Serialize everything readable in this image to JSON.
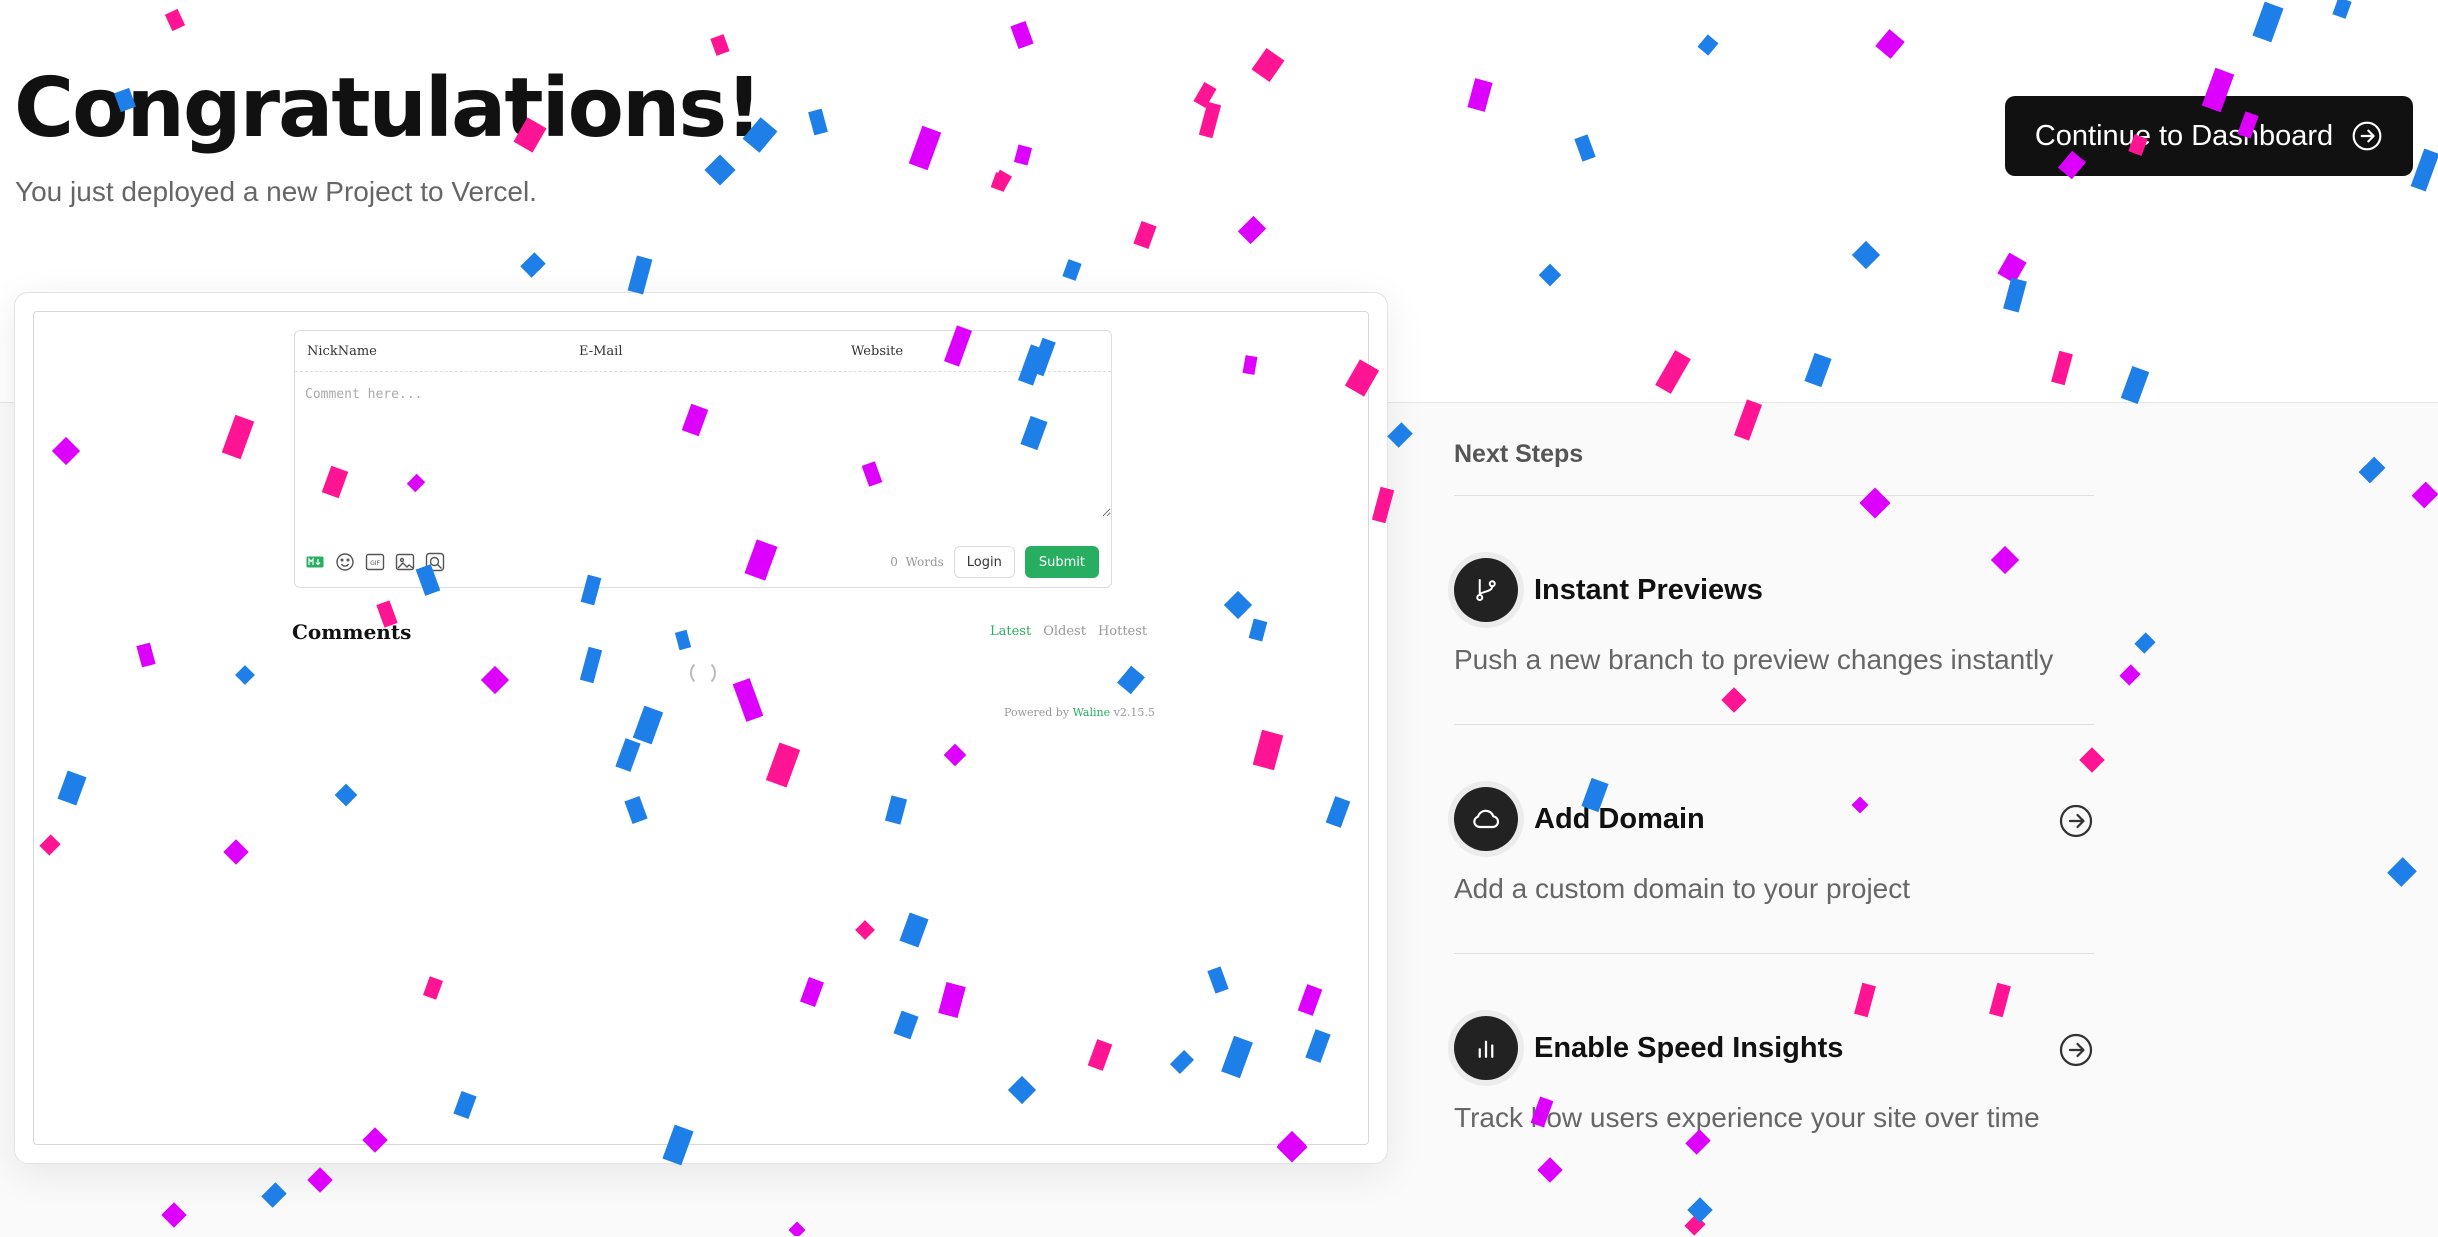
{
  "header": {
    "title": "Congratulations!",
    "subtitle": "You just deployed a new Project to Vercel.",
    "cta_label": "Continue to Dashboard",
    "cta_icon": "arrow-right-circle-icon"
  },
  "preview": {
    "fields": {
      "nickname": "NickName",
      "email": "E-Mail",
      "website": "Website"
    },
    "comment_placeholder": "Comment here...",
    "tool_icons": [
      "markdown-icon",
      "emoji-icon",
      "gif-icon",
      "image-icon",
      "preview-icon"
    ],
    "word_count": "0",
    "word_label": "Words",
    "login_label": "Login",
    "submit_label": "Submit",
    "comments_title": "Comments",
    "sort": [
      "Latest",
      "Oldest",
      "Hottest"
    ],
    "powered_prefix": "Powered by",
    "powered_name": "Waline",
    "powered_version": "v2.15.5"
  },
  "next_steps": {
    "title": "Next Steps",
    "items": [
      {
        "name": "Instant Previews",
        "description": "Push a new branch to preview changes instantly",
        "icon": "git-branch-icon",
        "has_arrow": false
      },
      {
        "name": "Add Domain",
        "description": "Add a custom domain to your project",
        "icon": "cloud-icon",
        "has_arrow": true
      },
      {
        "name": "Enable Speed Insights",
        "description": "Track how users experience your site over time",
        "icon": "bar-chart-icon",
        "has_arrow": true
      }
    ]
  },
  "colors": {
    "confetti": [
      "#ff1493",
      "#dd00ff",
      "#1e7fe8"
    ],
    "waline_accent": "#27ae60",
    "cta_background": "#111111"
  }
}
